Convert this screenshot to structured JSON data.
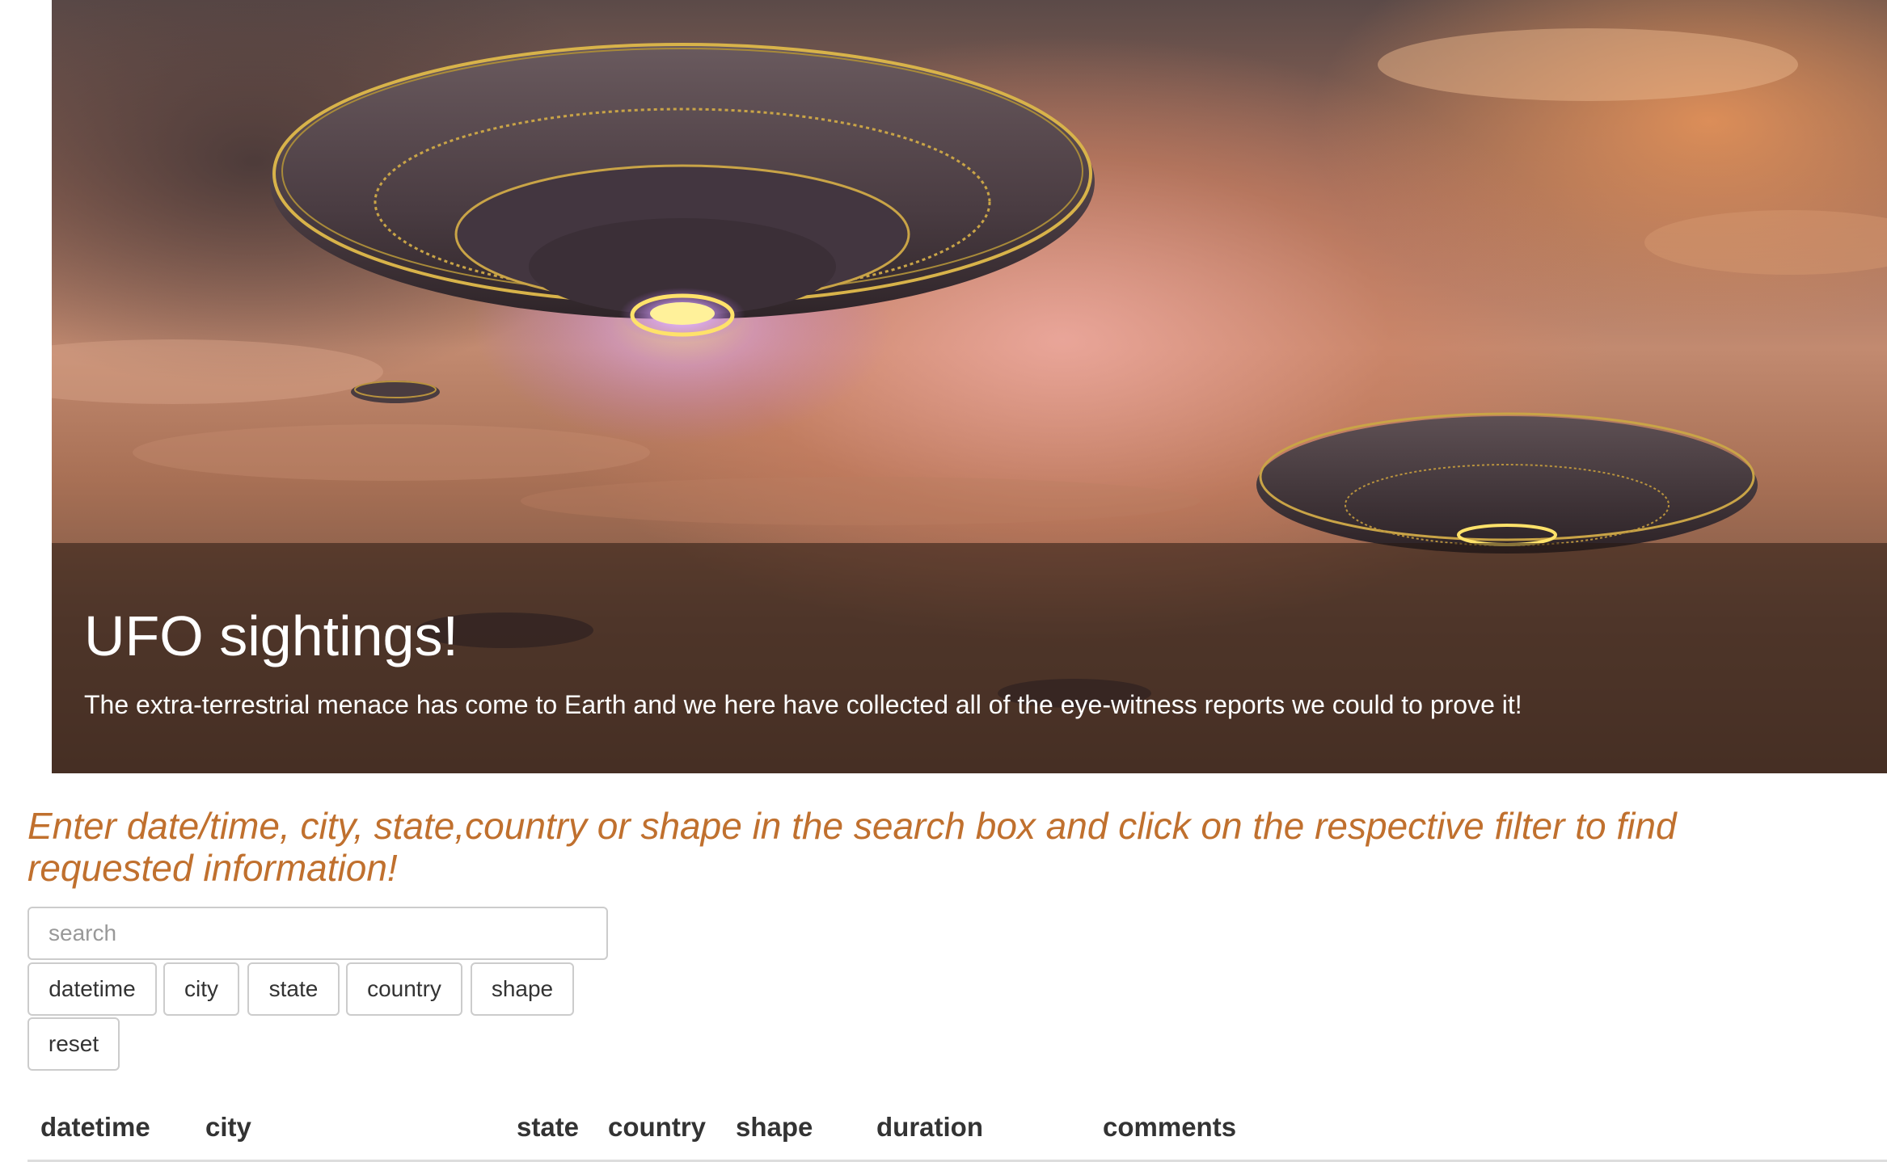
{
  "hero": {
    "title": "UFO sightings!",
    "subtitle": "The extra-terrestrial menace has come to Earth and we here have collected all of the eye-witness reports we could to prove it!"
  },
  "instructions": "Enter date/time, city, state,country or shape in the search box and click on the respective filter to find requested information!",
  "search": {
    "placeholder": "search",
    "value": ""
  },
  "filters": {
    "datetime": "datetime",
    "city": "city",
    "state": "state",
    "country": "country",
    "shape": "shape",
    "reset": "reset"
  },
  "table": {
    "columns": [
      "datetime",
      "city",
      "state",
      "country",
      "shape",
      "duration",
      "comments"
    ]
  },
  "colors": {
    "instruction_text": "#c0702e",
    "caption_overlay": "rgba(40,25,18,0.55)"
  }
}
